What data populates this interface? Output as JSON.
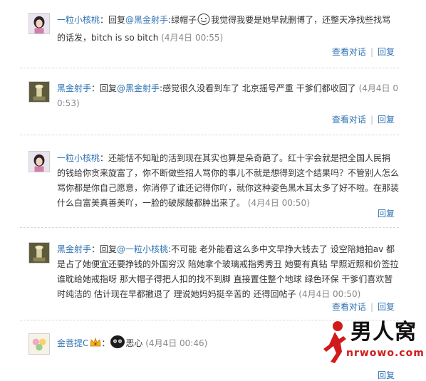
{
  "comments": [
    {
      "author": "一粒小核桃",
      "reply_prefix": "：回复",
      "mention": "@黑金射手",
      "text_before_emoticon": ":绿帽子",
      "emoticon": "smiley-face-icon",
      "text": "我觉得我要是她早就删博了，还整天净找些找骂的话发，bitch is so bitch",
      "time": "(4月4日 00:55)",
      "actions": [
        "查看对话",
        "回复"
      ]
    },
    {
      "author": "黑金射手",
      "reply_prefix": "：回复",
      "mention": "@黑金射手",
      "text": ":感觉很久没看到车了 北京摇号严重 干爹们都收回了",
      "time": "(4月4日 00:53)",
      "actions": [
        "查看对话",
        "回复"
      ]
    },
    {
      "author": "一粒小核桃",
      "text": "：还能恬不知耻的活到现在其实也算是朵奇葩了。红十字会就是把全国人民捐的钱给你贪来旋富了，你不断做些招人骂你的事儿不就是想得到这个结果吗？不管别人怎么骂你都是你自己愿意，你消停了谁还记得你吖，就你这种姿色黑木耳太多了好不啦。在那装什么白富美真善美吖，一脸的破尿酸都肿出来了。",
      "time": "(4月4日 00:50)",
      "actions": [
        "回复"
      ]
    },
    {
      "author": "黑金射手",
      "reply_prefix": "：回复",
      "mention": "@一粒小核桃",
      "text": ":不可能 老外能看这么多中文早挣大钱去了 设空陪她拍av 都是占了她便宜还要挣钱的外国穷汉 陪她拿个玻璃戒指秀秀丑 她要有真钻 早照近照和价签拉谁耽给她戒指呀 那大帽子得把人扣的找不到脚 直接置住整个地球 绿色环保 干爹们喜欢暂时纯洁的 估计现在早都撤退了 理说她妈妈挺辛苦的 还得回帖子",
      "time": "(4月4日 00:50)",
      "actions": [
        "查看对话",
        "回复"
      ]
    },
    {
      "author": "金菩提C",
      "crown": "crown-icon",
      "emoticon": "black-blob-emoticon-icon",
      "text": "恶心",
      "time": "(4月4日 00:46)",
      "actions": [
        "回复"
      ]
    }
  ],
  "watermark": {
    "title": "男人窝",
    "url": "nrwowo.com",
    "logo": "running-figure-logo-icon"
  },
  "colors": {
    "link": "#2f73b3",
    "time": "#888888",
    "watermark_red": "#d11b1b"
  }
}
